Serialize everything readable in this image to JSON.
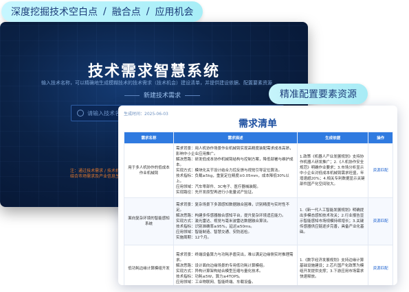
{
  "top_pill": {
    "part1": "深度挖掘技术空白点",
    "part2": "融合点",
    "part3": "应用机会",
    "sep": "/"
  },
  "dark_window": {
    "title": "技术需求智慧系统",
    "description": "输入技术名称，可以精确地生成模糊技术的技术需求（技术机会）建设清单，并提供建设依据、配置要素资源",
    "new_button": "新建技术需求",
    "search_placeholder": "请输入技术名称：",
    "warning": "注：通过技术需求 / 技术机会\n结合市场需求及产业信息生成"
  },
  "right_pill": {
    "label": "精准配置要素资源"
  },
  "card": {
    "date": "生成时间：2025-06-03",
    "title": "需求清单",
    "columns": [
      "需求名称",
      "需求描述",
      "生成依据",
      "操作"
    ],
    "rows": [
      {
        "name": "用于多人机协作的低成本作业机械臂",
        "desc": "需求背景：用人机协作场景作业机械臂实现高精度装配需求成本高昂，影响中小企业应用推广。\n解决思路：研发低成本协作机械臂结构与控制方案，降低部署与维护成本。\n实现方式：模块化关节设计结合力控反馈与视觉引导定位算法。\n技术指标：负载≥5kg，重复定位精度±0.05mm，成本降低30%以上。\n应用领域：汽车零部件、3C电子、医疗器械装配。\n实现路径：先开发原型再进行小批量试产验证。",
        "basis": "1.政策《机器人产业发展规划》支持协作机器人研发推广；2.《人机协作安全规范》明确作业要求；3.市场分析显示中小企业对低成本机械臂需求旺盛，年增速超20%；4.相关专利数据显示关键部件国产化空间较大。",
        "op": "资源匹配"
      },
      {
        "name": "面向复杂环境的智能感知系统",
        "desc": "需求背景：复杂场景下多源感知数据融合困难，识别精度与实时性不足。\n解决思路：构建多传感器融合感知平台，提升复杂环境适应能力。\n实现方式：激光雷达、视觉与毫米波雷达数据融合算法。\n技术指标：识别准确率≥95%，延迟≤50ms。\n应用领域：智能制造、智慧交通、安防巡检。\n实施周期：12个月。",
        "basis": "1.《新一代人工智能发展规划》明确提出多模态感知技术攻关；2.行业报告显示智能感知市场规模持续增长；3.关键传感器供应链逐步完善，具备产业化基础。",
        "op": "资源匹配"
      },
      {
        "name": "低功耗边缘计算模组开发",
        "desc": "需求背景：终端设备算力与功耗矛盾突出，难以满足边缘侧实时推理需求。\n解决思路：设计面向边缘场景的专用低功耗计算模组。\n实现方式：异构计算架构结合模型压缩与量化技术。\n技术指标：功耗≤5W，算力≥4TOPS。\n应用领域：工业物联网、智能终端、车载设备。",
        "basis": "1.《数字经济发展规划》支持边缘计算基础设施建设；2.芯片国产化政策为模组开发提供支撑；3.下游应用市场需求快速释放。",
        "op": "资源匹配"
      }
    ]
  }
}
